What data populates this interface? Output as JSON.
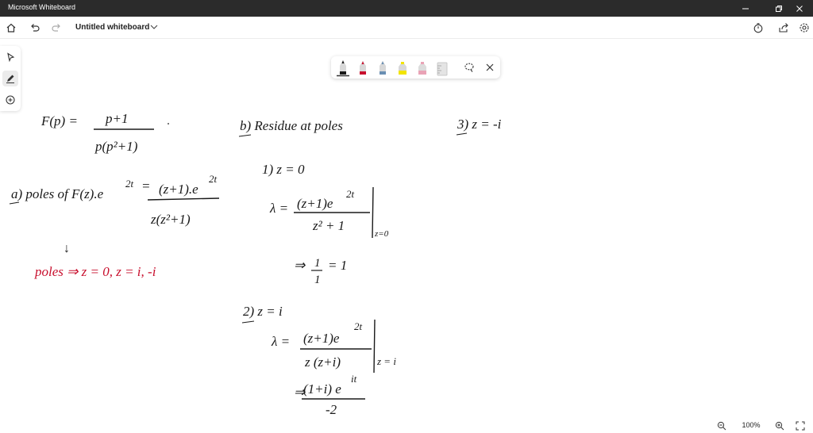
{
  "window": {
    "title": "Microsoft Whiteboard"
  },
  "toolbar": {
    "document_title": "Untitled whiteboard"
  },
  "zoom": {
    "level": "100%"
  },
  "colors": {
    "titlebar": "#2b2b2b",
    "ink_black": "#1a1a1a",
    "ink_red": "#c8102e",
    "pen_yellow": "#f2e400",
    "pen_red": "#c8102e",
    "pen_blue": "#6a8fb3"
  },
  "icons": {
    "window": [
      "minimize-icon",
      "restore-icon",
      "close-icon"
    ],
    "toolbar": [
      "home-icon",
      "undo-icon",
      "redo-icon",
      "chevron-down-icon",
      "timer-icon",
      "share-icon",
      "settings-icon"
    ],
    "rail": [
      "select-icon",
      "pen-icon",
      "add-icon"
    ],
    "tray": [
      "black-pen-icon",
      "red-pen-icon",
      "blue-pen-icon",
      "yellow-highlighter-icon",
      "pink-highlighter-icon",
      "ruler-icon",
      "lasso-icon",
      "close-icon"
    ],
    "zoom": [
      "zoom-out-icon",
      "zoom-in-icon",
      "fit-to-screen-icon"
    ]
  },
  "whiteboard_notes": {
    "f_lhs": "F(p) =",
    "f_num": "p+1",
    "f_den": "p(p²+1)",
    "b_heading": "b)  Residue at poles",
    "pole3": "3)  z = -i",
    "a_label": "a)  poles of F(z).e",
    "a_exp": "2t",
    "a_eq": "=",
    "a_num": "(z+1).e",
    "a_num_exp": "2t",
    "a_den": "z(z²+1)",
    "poles_arrow": "↓",
    "poles_line": "poles  ⇒  z = 0,  z = i, -i",
    "case1": "1)   z = 0",
    "r1_lhs": "λ =",
    "r1_num": "(z+1)e",
    "r1_num_exp": "2t",
    "r1_den": "z² + 1",
    "r1_eval": "z=0",
    "r1_result_arrow": "⇒",
    "r1_frac_num": "1",
    "r1_frac_den": "1",
    "r1_eq": "= 1",
    "case2": "2)   z = i",
    "r2_lhs": "λ =",
    "r2_num": "(z+1)e",
    "r2_num_exp": "2t",
    "r2_den": "z (z+i)",
    "r2_eval": "z = i",
    "r2_result_arrow": "⇒",
    "r2_res_num": "(1+i) e",
    "r2_res_exp": "it",
    "r2_res_den": "-2"
  }
}
